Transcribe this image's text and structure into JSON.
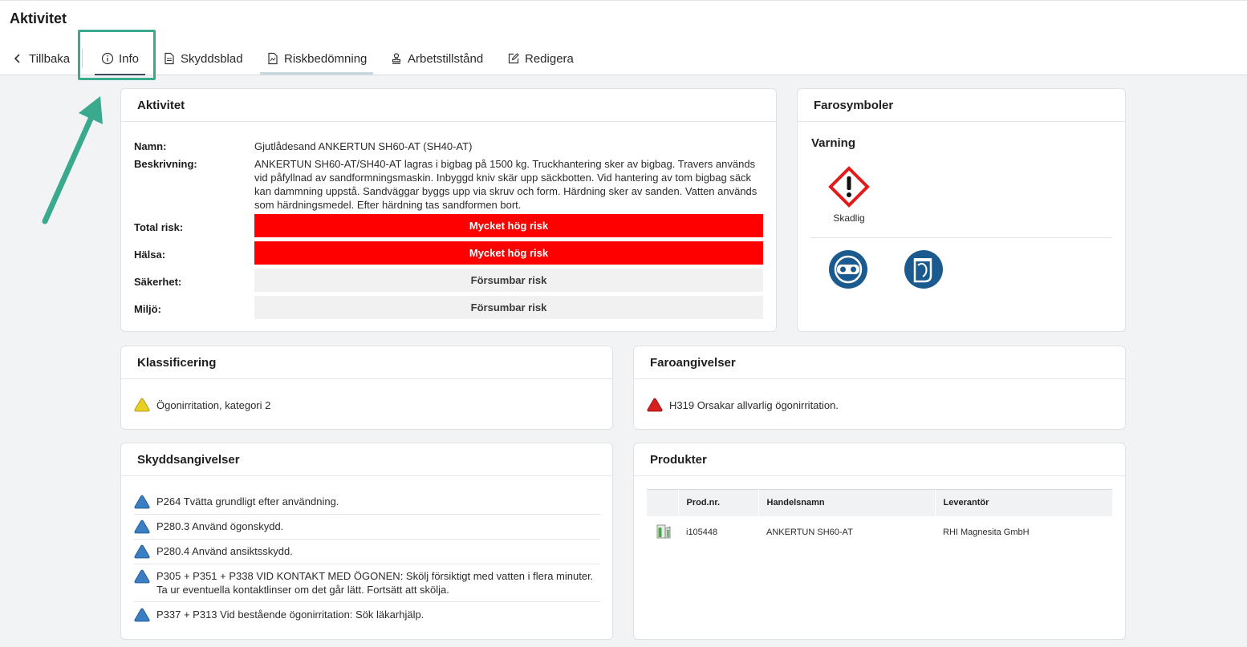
{
  "header": {
    "title": "Aktivitet",
    "tabs": {
      "back": "Tillbaka",
      "info": "Info",
      "skyddsblad": "Skyddsblad",
      "riskbedomning": "Riskbedömning",
      "arbetstillstand": "Arbetstillstånd",
      "redigera": "Redigera"
    }
  },
  "activity": {
    "title": "Aktivitet",
    "name_label": "Namn:",
    "name_value": "Gjutlådesand ANKERTUN SH60-AT (SH40-AT)",
    "desc_label": "Beskrivning:",
    "desc_value": "ANKERTUN SH60-AT/SH40-AT lagras i bigbag på 1500 kg. Truckhantering sker av bigbag. Travers används vid påfyllnad av sandformningsmaskin. Inbyggd kniv skär upp säckbotten. Vid hantering av tom bigbag säck kan dammning uppstå. Sandväggar byggs upp via skruv och form. Härdning sker av sanden. Vatten används som härdningsmedel. Efter härdning tas sandformen bort.",
    "total_label": "Total risk:",
    "total_value": "Mycket hög risk",
    "halsa_label": "Hälsa:",
    "halsa_value": "Mycket hög risk",
    "sakerhet_label": "Säkerhet:",
    "sakerhet_value": "Försumbar risk",
    "miljo_label": "Miljö:",
    "miljo_value": "Försumbar risk",
    "colors": {
      "high": "#ff0000",
      "low": "#f1f1f1"
    }
  },
  "farosymboler": {
    "title": "Farosymboler",
    "signal_word": "Varning",
    "ghs_label": "Skadlig",
    "ghs_icon": "exclamation-mark-icon",
    "ppe_icons": [
      "eye-protection-icon",
      "face-shield-icon"
    ]
  },
  "klassificering": {
    "title": "Klassificering",
    "item": "Ögonirritation, kategori 2"
  },
  "faroangivelser": {
    "title": "Faroangivelser",
    "item": "H319 Orsakar allvarlig ögonirritation."
  },
  "skyddsangivelser": {
    "title": "Skyddsangivelser",
    "items": [
      "P264 Tvätta grundligt efter användning.",
      "P280.3 Använd ögonskydd.",
      "P280.4 Använd ansiktsskydd.",
      "P305 + P351 + P338 VID KONTAKT MED ÖGONEN: Skölj försiktigt med vatten i flera minuter. Ta ur eventuella kontaktlinser om det går lätt. Fortsätt att skölja.",
      "P337 + P313 Vid bestående ögonirritation: Sök läkarhjälp."
    ]
  },
  "produkter": {
    "title": "Produkter",
    "columns": [
      "Prod.nr.",
      "Handelsnamn",
      "Leverantör"
    ],
    "rows": [
      {
        "prodnr": "i105448",
        "handelsnamn": "ANKERTUN SH60-AT",
        "leverantor": "RHI Magnesita GmbH"
      }
    ]
  }
}
